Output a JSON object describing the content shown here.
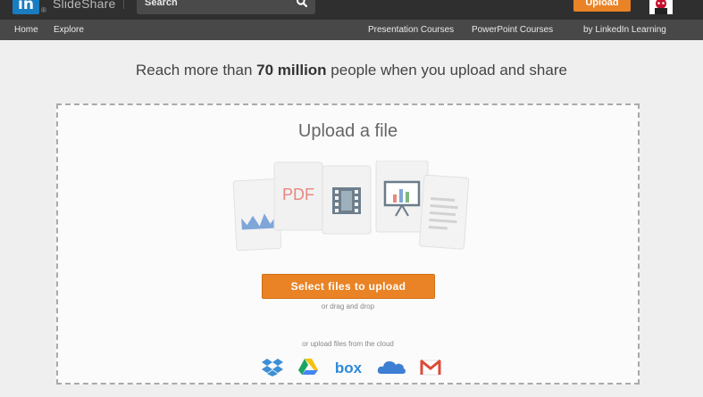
{
  "brand": {
    "logo_mark": "in",
    "name": "SlideShare",
    "registered": "®"
  },
  "search": {
    "placeholder": "Search"
  },
  "header": {
    "upload_label": "Upload"
  },
  "nav": {
    "left": [
      {
        "label": "Home"
      },
      {
        "label": "Explore"
      }
    ],
    "right": [
      {
        "label": "Presentation Courses"
      },
      {
        "label": "PowerPoint Courses"
      },
      {
        "label": "by LinkedIn Learning"
      }
    ]
  },
  "hero": {
    "text_before": "Reach more than ",
    "text_bold": "70 million",
    "text_after": " people when you upload and share"
  },
  "upload": {
    "title": "Upload a file",
    "file_types": [
      "chart",
      "PDF",
      "video",
      "presentation",
      "document"
    ],
    "pdf_label": "PDF",
    "button_label": "Select files to upload",
    "drag_text": "or drag and drop",
    "cloud_text": "or upload files from the cloud",
    "cloud_services": [
      "Dropbox",
      "Google Drive",
      "box",
      "OneDrive",
      "Gmail"
    ],
    "box_label": "box"
  },
  "colors": {
    "accent": "#e98325",
    "linkedin_blue": "#1a7cc0",
    "topbar": "#2f2f2f",
    "navbar": "#484848"
  }
}
